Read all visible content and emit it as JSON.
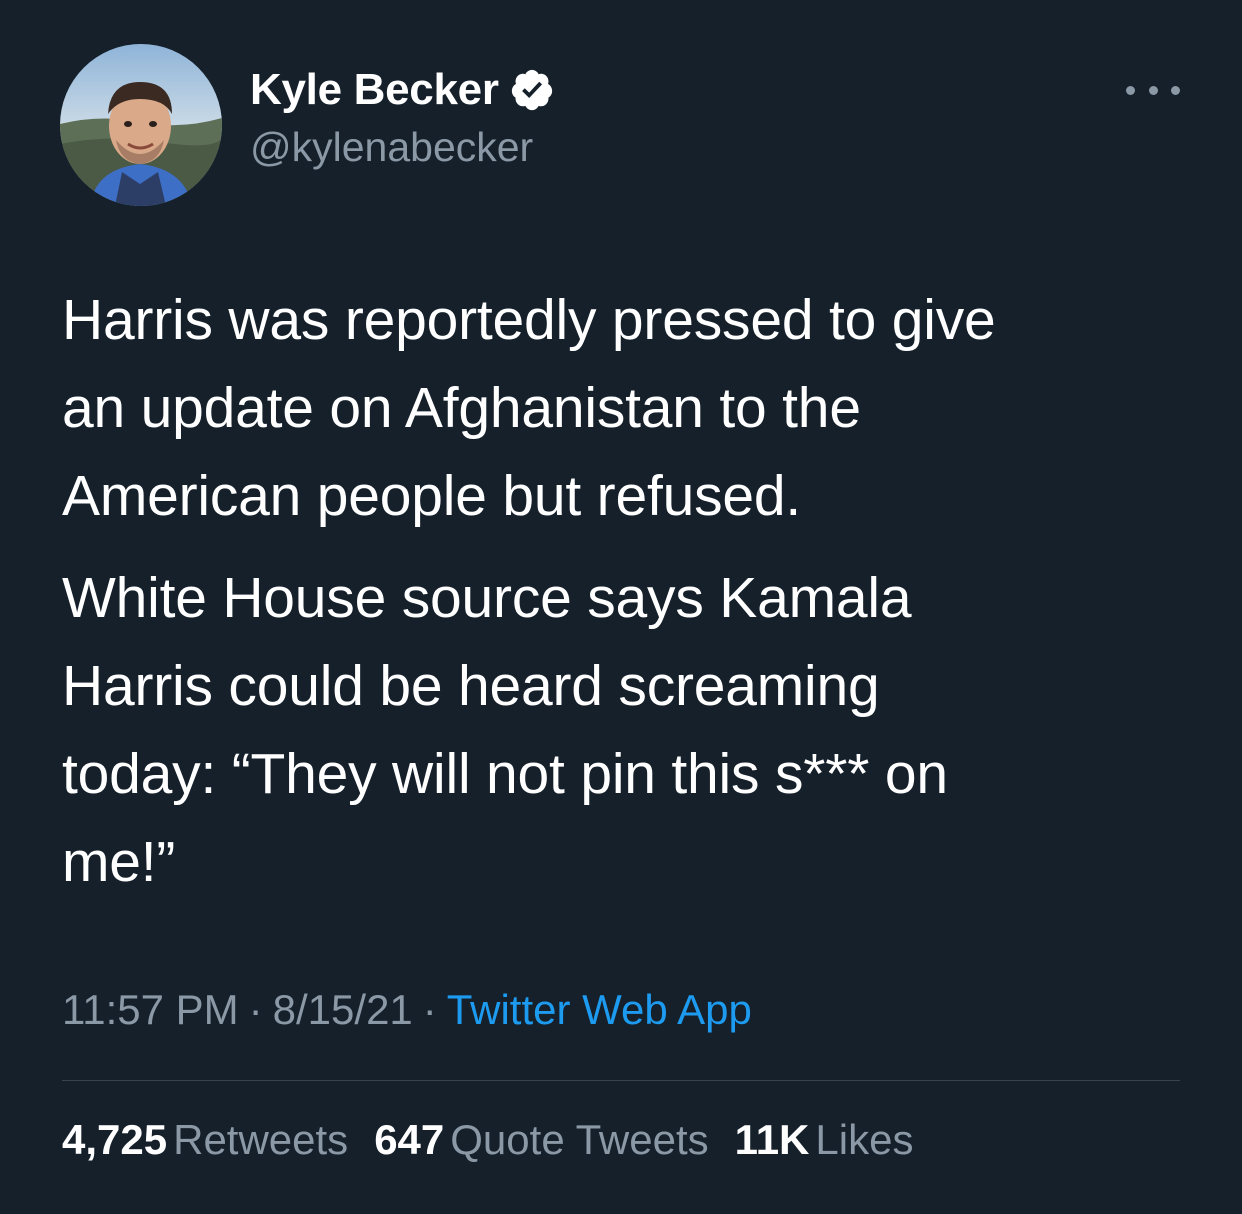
{
  "author": {
    "display_name": "Kyle Becker",
    "handle": "@kylenabecker",
    "verified": true
  },
  "tweet": {
    "paragraphs": [
      "Harris was reportedly pressed to give\nan update on Afghanistan to the\nAmerican people but refused.",
      "White House source says Kamala\nHarris could be heard screaming\ntoday: “They will not pin this s*** on\nme!”"
    ],
    "time": "11:57 PM",
    "separator": "·",
    "date": "8/15/21",
    "source": "Twitter Web App"
  },
  "stats": [
    {
      "count": "4,725",
      "label": "Retweets"
    },
    {
      "count": "647",
      "label": "Quote Tweets"
    },
    {
      "count": "11K",
      "label": "Likes"
    }
  ],
  "colors": {
    "background": "#15202b",
    "text_primary": "#ffffff",
    "text_secondary": "#8b98a5",
    "accent": "#1d9bf0",
    "divider": "#38444d"
  },
  "icons": {
    "verified": "verified-badge-icon",
    "more": "more-horizontal-icon"
  }
}
